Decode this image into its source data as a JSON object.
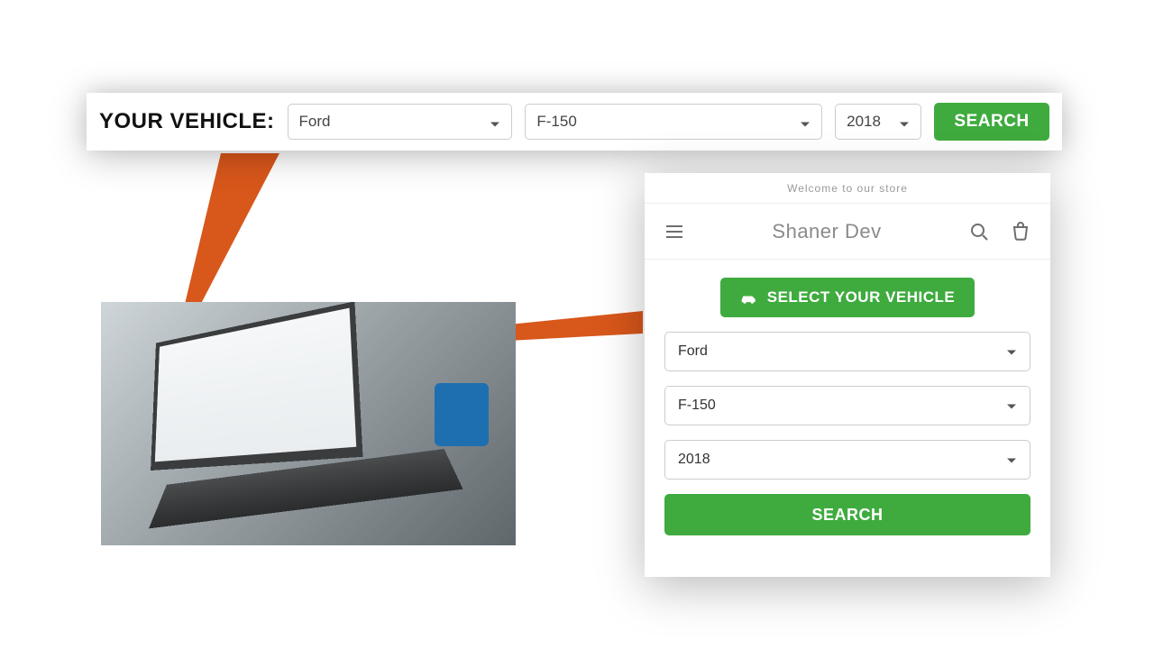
{
  "top_bar": {
    "label": "YOUR VEHICLE:",
    "make": "Ford",
    "model": "F-150",
    "year": "2018",
    "search_label": "SEARCH"
  },
  "mobile": {
    "welcome": "Welcome to our store",
    "store_name": "Shaner Dev",
    "select_vehicle_label": "SELECT YOUR VEHICLE",
    "make": "Ford",
    "model": "F-150",
    "year": "2018",
    "search_label": "SEARCH"
  },
  "colors": {
    "accent_green": "#3fab3f",
    "callout_orange": "#d8571b"
  }
}
